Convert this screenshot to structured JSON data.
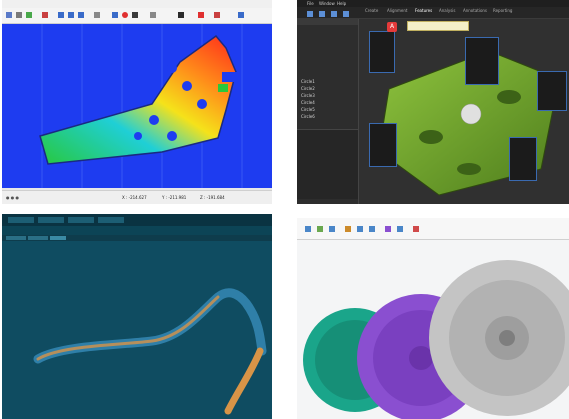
{
  "q1": {
    "status": {
      "coord_x": "X : -214.627",
      "coord_y": "Y : -211.981",
      "coord_z": "Z : -191.684"
    },
    "colors": {
      "background": "#1e3cf0",
      "part_high": "#ff2a1a",
      "part_mid": "#f5e21a",
      "part_low": "#28c83c"
    }
  },
  "q2": {
    "menu": [
      "File",
      "Window",
      "Help"
    ],
    "toolbar_tabs": [
      "Create",
      "Alignment",
      "Features",
      "Analysis",
      "Annotations",
      "Reporting"
    ],
    "tree_items": [
      "Circle1",
      "Circle2",
      "Circle3",
      "Circle4",
      "Circle5",
      "Circle6"
    ],
    "selected_tab_letter": "A",
    "colors": {
      "part": "#6ea22a",
      "accent": "#3a6ab0"
    }
  },
  "q3": {
    "colors": {
      "background": "#0f4c61",
      "tube": "#2f7fa8",
      "tube_highlight": "#d89447"
    }
  },
  "q4": {
    "colors": {
      "wheel_green": "#1aa58a",
      "wheel_purple": "#8a4fd0",
      "wheel_gray": "#b8b8b8"
    }
  }
}
